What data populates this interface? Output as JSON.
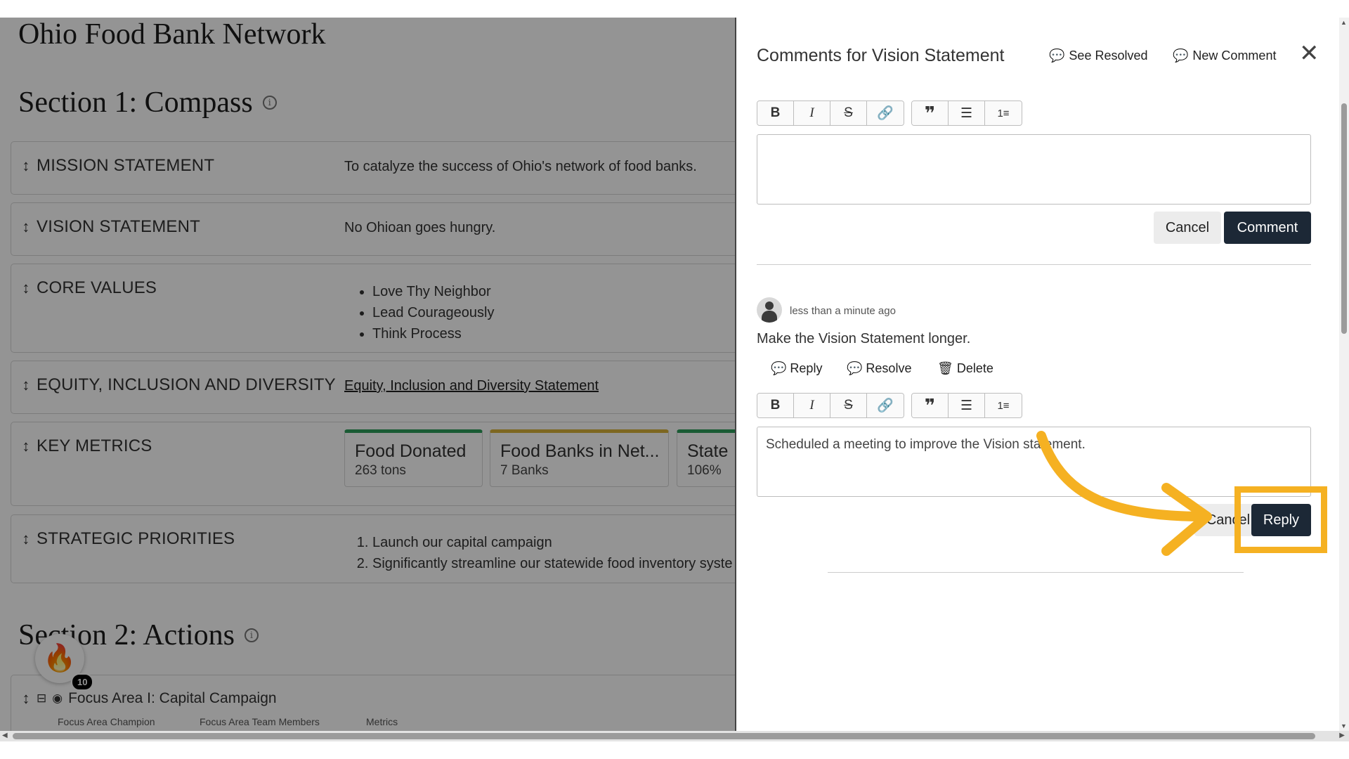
{
  "page": {
    "org_title": "Ohio Food Bank Network",
    "section1_title": "Section 1: Compass",
    "section2_title": "Section 2: Actions",
    "cards": {
      "mission": {
        "label": "MISSION STATEMENT",
        "value": "To catalyze the success of Ohio's network of food banks."
      },
      "vision": {
        "label": "VISION STATEMENT",
        "value": "No Ohioan goes hungry."
      },
      "core_values": {
        "label": "CORE VALUES",
        "items": [
          "Love Thy Neighbor",
          "Lead Courageously",
          "Think Process"
        ]
      },
      "equity": {
        "label": "EQUITY, INCLUSION AND DIVERSITY",
        "link": "Equity, Inclusion and Diversity Statement"
      },
      "key_metrics": {
        "label": "KEY METRICS",
        "metrics": [
          {
            "name": "Food Donated",
            "value": "263 tons",
            "color": "#2e9e5b"
          },
          {
            "name": "Food Banks in Net...",
            "value": "7 Banks",
            "color": "#d8b23a"
          },
          {
            "name": "State",
            "value": "106%",
            "color": "#2e9e5b"
          }
        ]
      },
      "priorities": {
        "label": "STRATEGIC PRIORITIES",
        "items": [
          "Launch our capital campaign",
          "Significantly streamline our statewide food inventory syste"
        ]
      }
    },
    "focus_area": {
      "title": "Focus Area I: Capital Campaign",
      "champion_label": "Focus Area Champion",
      "team_label": "Focus Area Team Members",
      "metrics_label": "Metrics"
    },
    "fire_badge_count": "10"
  },
  "panel": {
    "title": "Comments for Vision Statement",
    "see_resolved": "See Resolved",
    "new_comment": "New Comment",
    "close_glyph": "✕",
    "toolbar": [
      "bold-icon",
      "italic-icon",
      "strikethrough-icon",
      "link-icon",
      "quote-icon",
      "bullet-list-icon",
      "numbered-list-icon"
    ],
    "new_comment_editor": {
      "value": ""
    },
    "cancel_label": "Cancel",
    "comment_label": "Comment",
    "comment": {
      "timestamp": "less than a minute ago",
      "text": "Make the Vision Statement longer.",
      "reply_action": "Reply",
      "resolve_action": "Resolve",
      "delete_action": "Delete"
    },
    "reply_editor": {
      "value": "Scheduled a meeting to improve the Vision statement."
    },
    "reply_cancel_label": "Cancel",
    "reply_submit_label": "Reply"
  },
  "accent_colors": {
    "highlight": "#f5b122",
    "dark_button": "#1c2836"
  }
}
